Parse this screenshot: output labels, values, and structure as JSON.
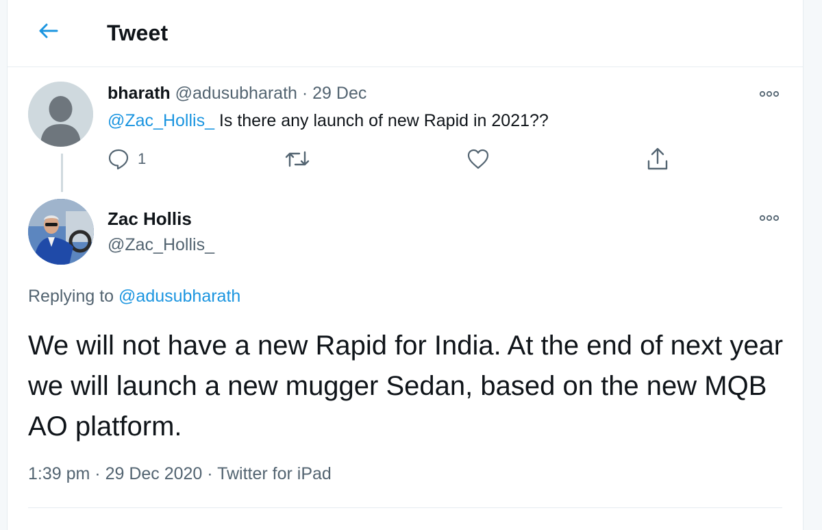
{
  "header": {
    "title": "Tweet"
  },
  "parent_tweet": {
    "display_name": "bharath",
    "handle": "@adusubharath",
    "separator": " · ",
    "date": "29 Dec",
    "mention": "@Zac_Hollis_",
    "text": " Is there any launch of new Rapid in 2021??",
    "reply_count": "1"
  },
  "main_tweet": {
    "display_name": "Zac Hollis",
    "handle": "@Zac_Hollis_",
    "replying_prefix": "Replying to ",
    "replying_to": "@adusubharath",
    "text": "We will not have a new Rapid for India. At the end of next year we will launch a new mugger Sedan, based on the new MQB AO platform.",
    "time": "1:39 pm",
    "date": "29 Dec 2020",
    "source": "Twitter for iPad",
    "meta_separator": " · "
  },
  "colors": {
    "accent": "#1b95e0",
    "muted": "#536471",
    "border": "#e6ecf0"
  },
  "icons": [
    "back-arrow-icon",
    "more-icon",
    "reply-icon",
    "retweet-icon",
    "like-icon",
    "share-icon"
  ]
}
